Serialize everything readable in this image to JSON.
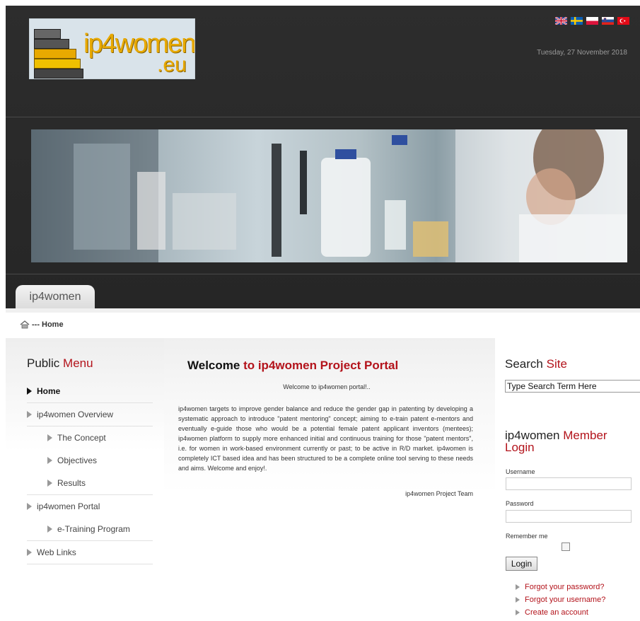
{
  "header": {
    "logo_main": "ip4women",
    "logo_suffix": ".eu",
    "date": "Tuesday, 27 November 2018",
    "flags": [
      "uk-flag",
      "sweden-flag",
      "poland-flag",
      "slovenia-flag",
      "turkey-flag"
    ]
  },
  "tab": {
    "label": "ip4women"
  },
  "breadcrumb": {
    "sep": "---",
    "home": "Home"
  },
  "menu": {
    "title_a": "Public",
    "title_b": "Menu",
    "items": [
      {
        "label": "Home",
        "level": "top"
      },
      {
        "label": "ip4women Overview",
        "level": "top"
      },
      {
        "label": "The Concept",
        "level": "sub"
      },
      {
        "label": "Objectives",
        "level": "sub"
      },
      {
        "label": "Results",
        "level": "sub"
      },
      {
        "label": "ip4women Portal",
        "level": "top"
      },
      {
        "label": "e-Training Program",
        "level": "sub"
      },
      {
        "label": "Web Links",
        "level": "top"
      }
    ]
  },
  "content": {
    "title_a": "Welcome",
    "title_b": "to ip4women Project Portal",
    "intro": "Welcome to ip4women portal!..",
    "body": "ip4women targets to improve gender balance and reduce the gender gap in patenting by developing a systematic approach to introduce \"patent mentoring\" concept; aiming to e-train patent e-mentors and eventually e-guide those who would be a potential female patent applicant inventors (mentees); ip4women platform to supply more enhanced initial and continuous training for those  \"patent mentors\", i.e. for women in work-based environment currently or past; to be active in R/D market. ip4women is completely ICT based idea and has been structured to be a complete online tool serving to these needs and aims. Welcome and enjoy!.",
    "signature": "ip4women Project Team"
  },
  "search": {
    "title_a": "Search",
    "title_b": "Site",
    "value": "Type Search Term Here"
  },
  "login": {
    "title_a": "ip4women",
    "title_b": "Member",
    "title_c": "Login",
    "username_label": "Username",
    "password_label": "Password",
    "remember_label": "Remember me",
    "button": "Login",
    "links": [
      "Forgot your password?",
      "Forgot your username?",
      "Create an account"
    ]
  },
  "colors": {
    "accent": "#b3131b",
    "header_bg": "#2b2b2b"
  }
}
